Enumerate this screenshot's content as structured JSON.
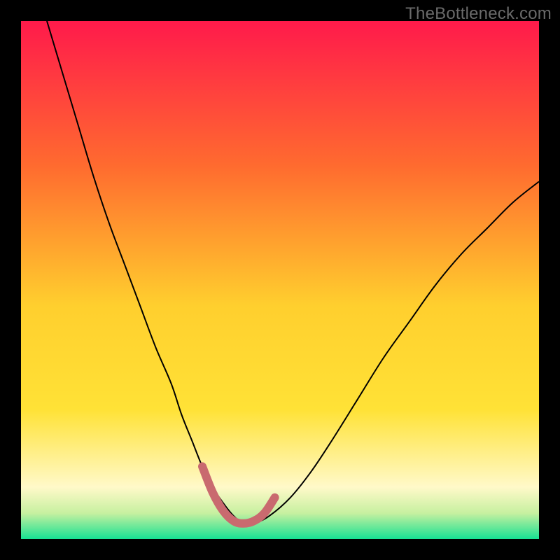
{
  "watermark": "TheBottleneck.com",
  "chart_data": {
    "type": "line",
    "title": "",
    "xlabel": "",
    "ylabel": "",
    "xlim": [
      0,
      100
    ],
    "ylim": [
      0,
      100
    ],
    "grid": false,
    "legend": false,
    "background_gradient": {
      "top_color": "#ff1a4b",
      "mid_color": "#ffe236",
      "band_color": "#fff9c9",
      "bottom_color": "#17e193"
    },
    "series": [
      {
        "name": "bottleneck-curve",
        "color": "#000000",
        "stroke_width": 2,
        "x": [
          5,
          8,
          11,
          14,
          17,
          20,
          23,
          26,
          29,
          31,
          33,
          35,
          37,
          39,
          41,
          43,
          45,
          48,
          52,
          56,
          60,
          65,
          70,
          75,
          80,
          85,
          90,
          95,
          100
        ],
        "y": [
          100,
          90,
          80,
          70,
          61,
          53,
          45,
          37,
          30,
          24,
          19,
          14,
          10,
          7,
          4.5,
          3,
          3,
          4.5,
          8,
          13,
          19,
          27,
          35,
          42,
          49,
          55,
          60,
          65,
          69
        ]
      },
      {
        "name": "valley-marker",
        "color": "#c96a6f",
        "stroke_width": 12,
        "linecap": "round",
        "x": [
          35,
          37,
          39,
          41,
          43,
          45,
          47,
          49
        ],
        "y": [
          14,
          9,
          5.5,
          3.5,
          3,
          3.5,
          5,
          8
        ]
      }
    ]
  }
}
